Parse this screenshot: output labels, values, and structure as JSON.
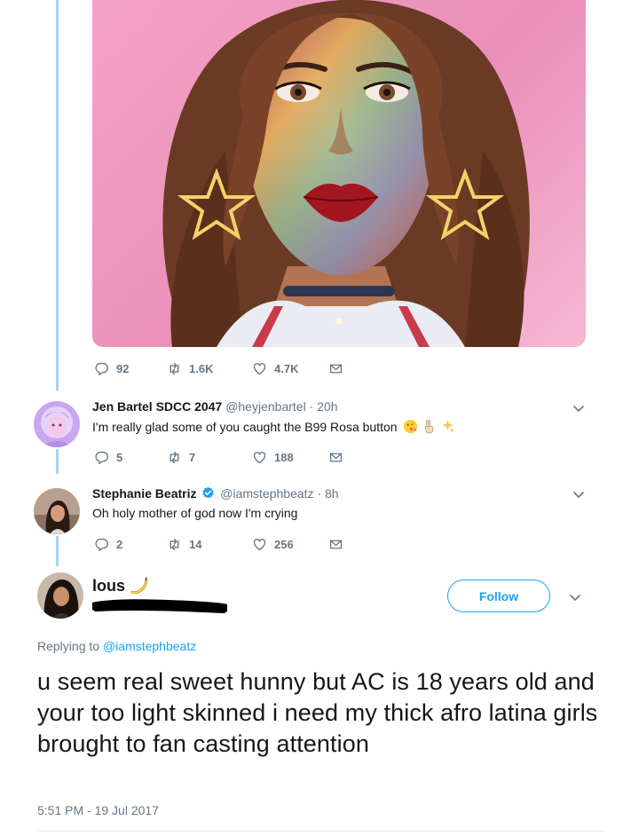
{
  "thread": {
    "original_tweet": {
      "actions": {
        "replies": "92",
        "retweets": "1.6K",
        "likes": "4.7K"
      }
    },
    "replies": [
      {
        "name": "Jen Bartel SDCC 2047",
        "handle": "@heyjenbartel",
        "time": "· 20h",
        "text": "I'm really glad some of you caught the B99 Rosa button",
        "emojis": [
          "face-blowing-kiss-icon",
          "victory-hand-icon",
          "sparkles-icon"
        ],
        "actions": {
          "replies": "5",
          "retweets": "7",
          "likes": "188"
        }
      },
      {
        "name": "Stephanie Beatriz",
        "verified": true,
        "handle": "@iamstephbeatz",
        "time": "· 8h",
        "text": "Oh holy mother of god now I'm crying",
        "actions": {
          "replies": "2",
          "retweets": "14",
          "likes": "256"
        }
      }
    ]
  },
  "main_tweet": {
    "name": "lous",
    "name_emoji": "banana-icon",
    "follow_label": "Follow",
    "replying_prefix": "Replying to",
    "replying_to": "@iamstephbeatz",
    "text": "u seem real sweet hunny but AC is 18 years old and your too light skinned i need my thick afro latina girls brought to fan casting attention",
    "timestamp": "5:51 PM - 19 Jul 2017"
  },
  "colors": {
    "accent": "#1da1f2",
    "muted": "#657786",
    "thread_line": "#a8d4f2",
    "text": "#14171a"
  }
}
